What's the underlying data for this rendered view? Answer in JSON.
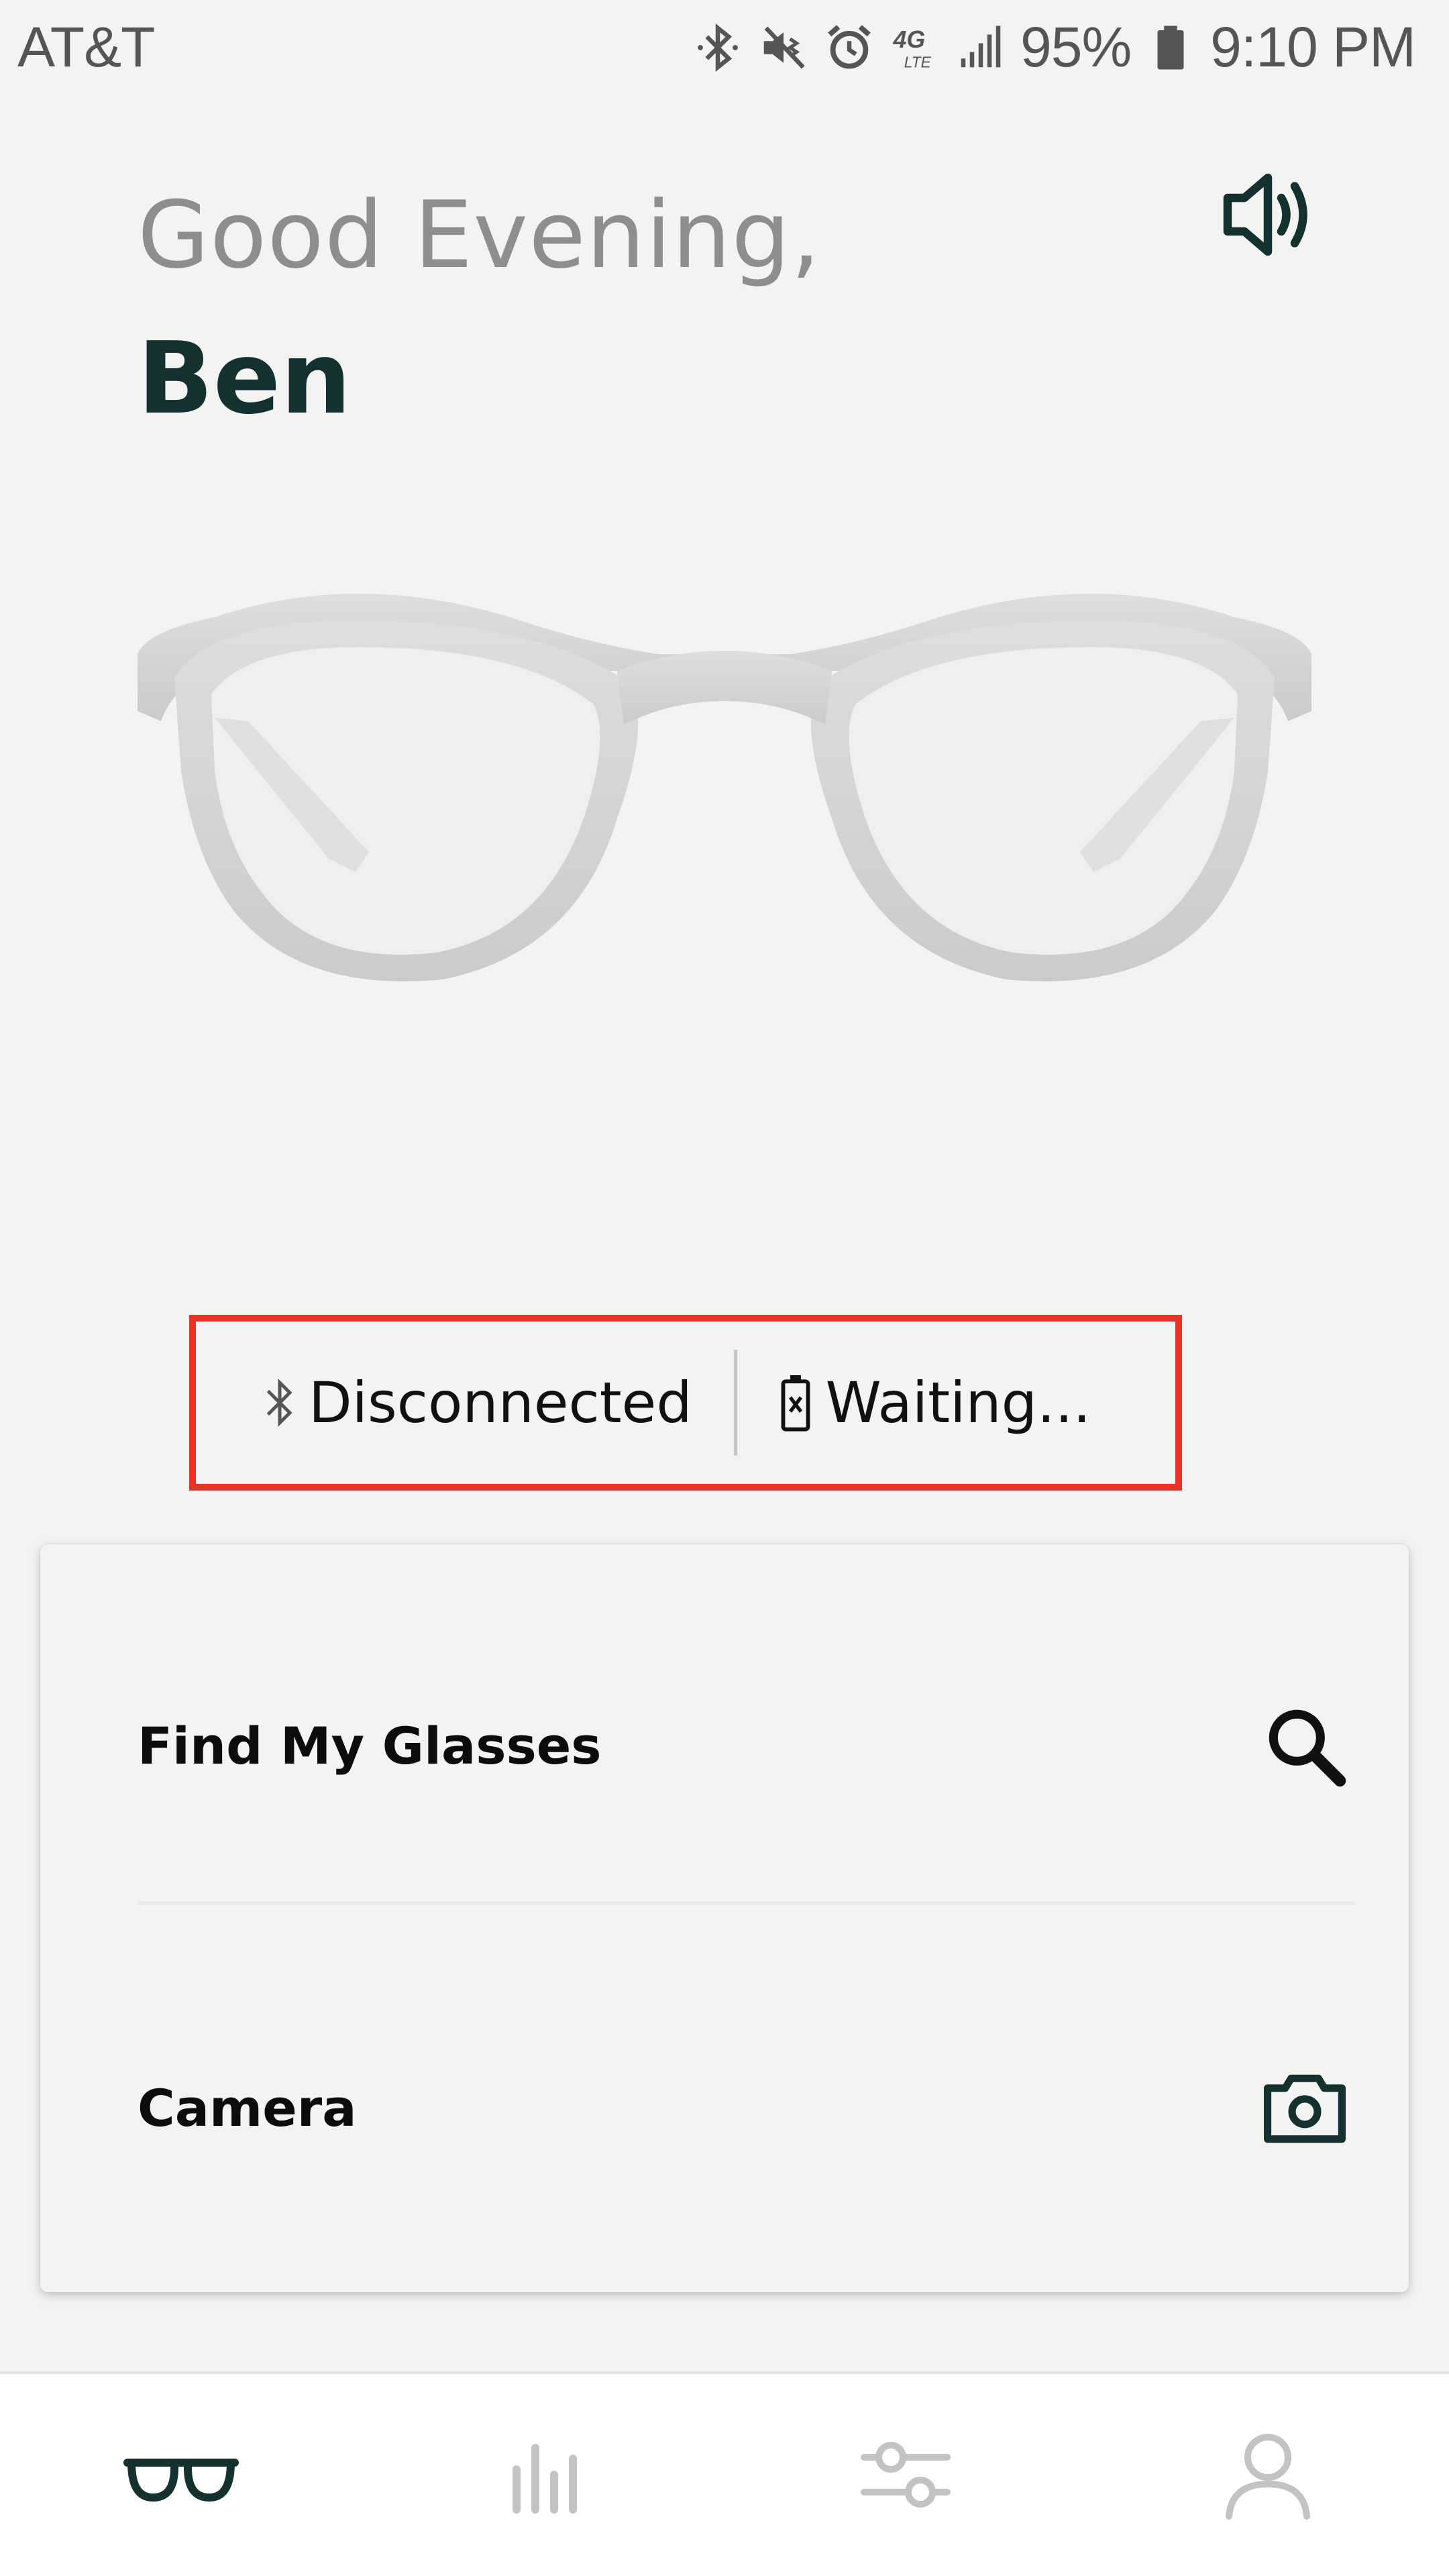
{
  "status_bar": {
    "carrier": "AT&T",
    "battery_percent": "95%",
    "time": "9:10 PM",
    "network": "4G LTE",
    "icons": [
      "bluetooth-icon",
      "vibrate-mute-icon",
      "alarm-icon",
      "lte-icon",
      "signal-icon",
      "battery-icon"
    ]
  },
  "header": {
    "greeting": "Good Evening,",
    "user_name": "Ben",
    "volume_icon": "speaker-volume-icon"
  },
  "device": {
    "image": "glasses-frame-illustration",
    "bluetooth_status": "Disconnected",
    "battery_status": "Waiting..."
  },
  "actions": [
    {
      "label": "Find My Glasses",
      "icon": "search-icon"
    },
    {
      "label": "Camera",
      "icon": "camera-icon"
    }
  ],
  "bottom_nav": {
    "items": [
      {
        "icon": "glasses-icon",
        "active": true
      },
      {
        "icon": "bar-chart-icon",
        "active": false
      },
      {
        "icon": "sliders-icon",
        "active": false
      },
      {
        "icon": "profile-icon",
        "active": false
      }
    ]
  },
  "colors": {
    "accent": "#14312f",
    "highlight_border": "#e83326",
    "inactive_nav": "#c3c3c3",
    "greeting_gray": "#8e8e8e",
    "background": "#f3f3f3"
  }
}
